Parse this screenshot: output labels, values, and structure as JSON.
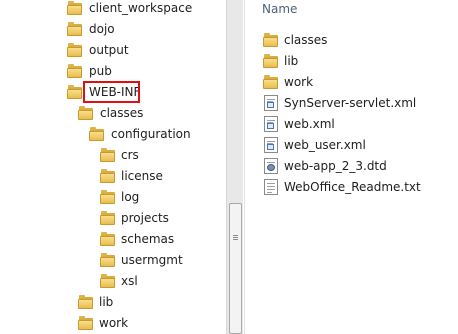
{
  "tree": {
    "items": [
      {
        "label": "client_workspace"
      },
      {
        "label": "dojo"
      },
      {
        "label": "output"
      },
      {
        "label": "pub"
      },
      {
        "label": "WEB-INF"
      },
      {
        "label": "classes"
      },
      {
        "label": "configuration"
      },
      {
        "label": "crs"
      },
      {
        "label": "license"
      },
      {
        "label": "log"
      },
      {
        "label": "projects"
      },
      {
        "label": "schemas"
      },
      {
        "label": "usermgmt"
      },
      {
        "label": "xsl"
      },
      {
        "label": "lib"
      },
      {
        "label": "work"
      }
    ],
    "highlighted": "WEB-INF"
  },
  "files": {
    "header": "Name",
    "items": [
      {
        "label": "classes",
        "icon": "folder-icon"
      },
      {
        "label": "lib",
        "icon": "folder-icon"
      },
      {
        "label": "work",
        "icon": "folder-icon"
      },
      {
        "label": "SynServer-servlet.xml",
        "icon": "xml-file-icon"
      },
      {
        "label": "web.xml",
        "icon": "xml-file-icon"
      },
      {
        "label": "web_user.xml",
        "icon": "xml-file-icon"
      },
      {
        "label": "web-app_2_3.dtd",
        "icon": "dtd-file-icon"
      },
      {
        "label": "WebOffice_Readme.txt",
        "icon": "text-file-icon"
      }
    ]
  },
  "colors": {
    "folder": "#e9bd4e",
    "highlight_border": "#e01010",
    "header_text": "#4c607a"
  }
}
